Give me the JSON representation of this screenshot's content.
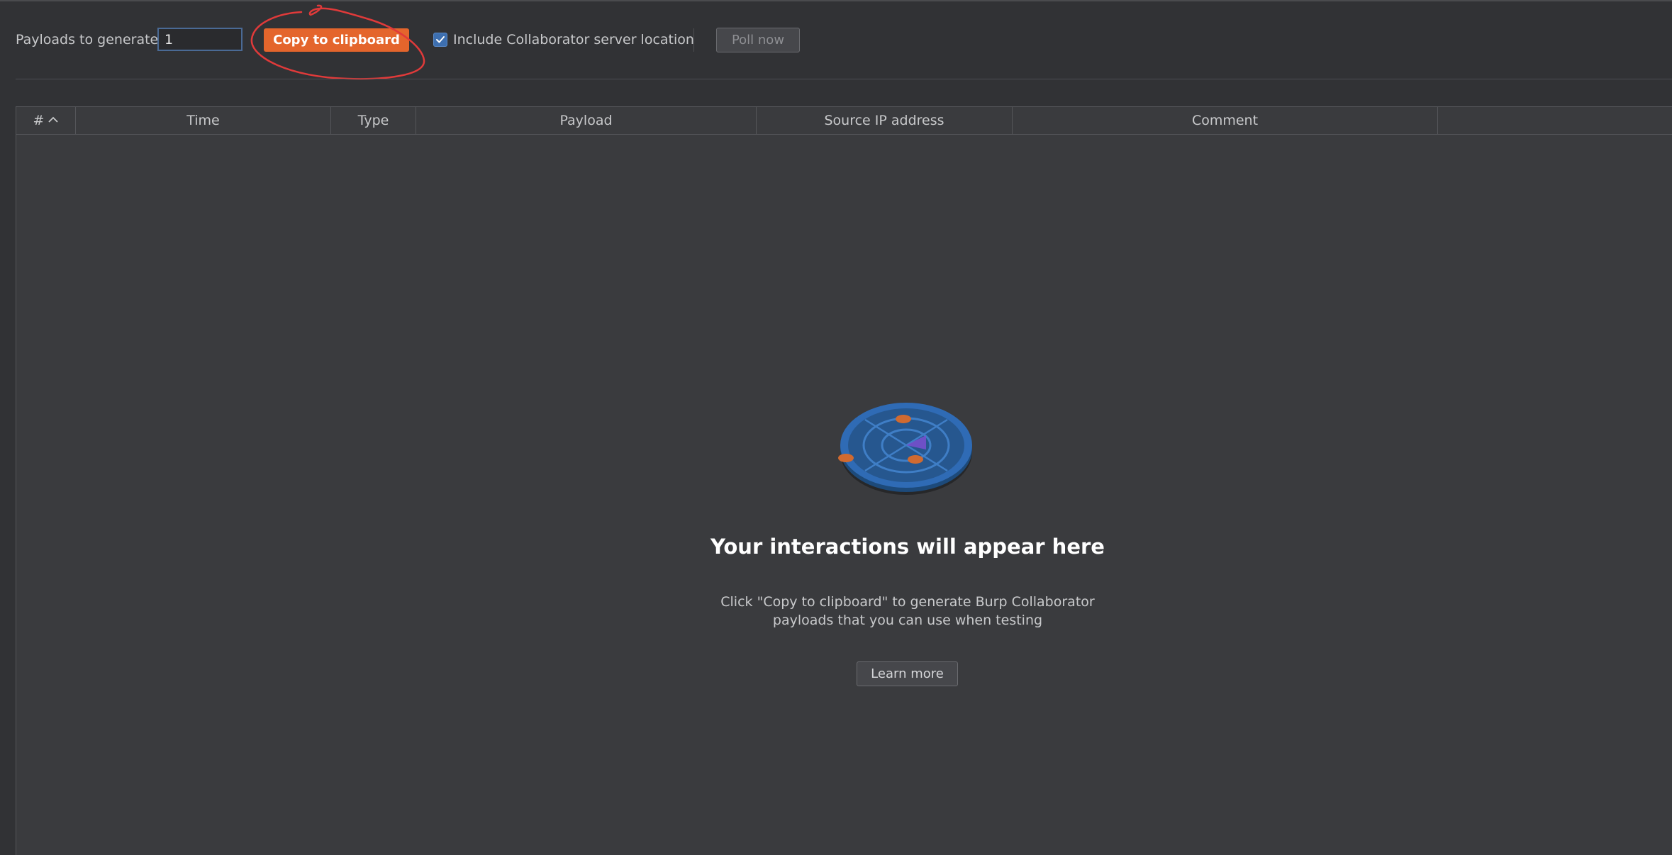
{
  "toolbar": {
    "payloads_label": "Payloads to generate:",
    "payloads_value": "1",
    "copy_button": "Copy to clipboard",
    "include_location_label": "Include Collaborator server location",
    "include_location_checked": true,
    "poll_button": "Poll now"
  },
  "table": {
    "columns": [
      "#",
      "Time",
      "Type",
      "Payload",
      "Source IP address",
      "Comment"
    ],
    "sort_column": "#",
    "sort_direction": "ascending"
  },
  "empty_state": {
    "icon": "radar-icon",
    "title": "Your interactions will appear here",
    "description_line1": "Click \"Copy to clipboard\" to generate Burp Collaborator",
    "description_line2": "payloads that you can use when testing",
    "learn_more": "Learn more"
  },
  "colors": {
    "background": "#313235",
    "accent": "#e4652c",
    "checkbox": "#3d6fb0",
    "annotation": "#e03a3a"
  }
}
